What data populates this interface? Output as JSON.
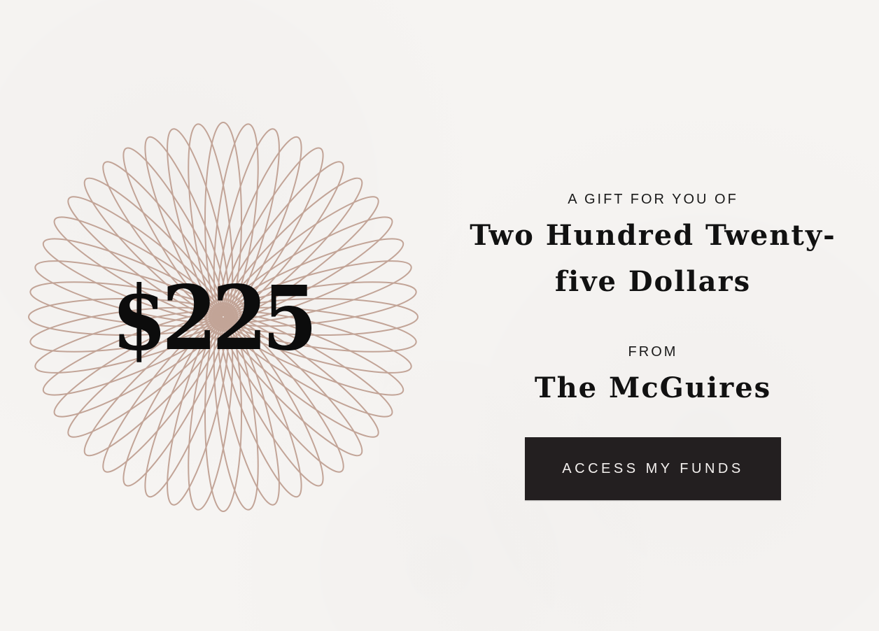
{
  "gift": {
    "amount": "$225",
    "eyebrow": "A GIFT FOR YOU OF",
    "amount_words": "Two Hundred Twenty-five Dollars",
    "from_label": "FROM",
    "sender": "The McGuires",
    "cta_label": "ACCESS MY FUNDS"
  },
  "theme": {
    "background": "#f6f4f2",
    "rosette_color": "#c2a497",
    "button_color": "#231f20",
    "text_color": "#111111"
  },
  "decor": {
    "rosette_icon": "spirograph-rosette-icon"
  }
}
